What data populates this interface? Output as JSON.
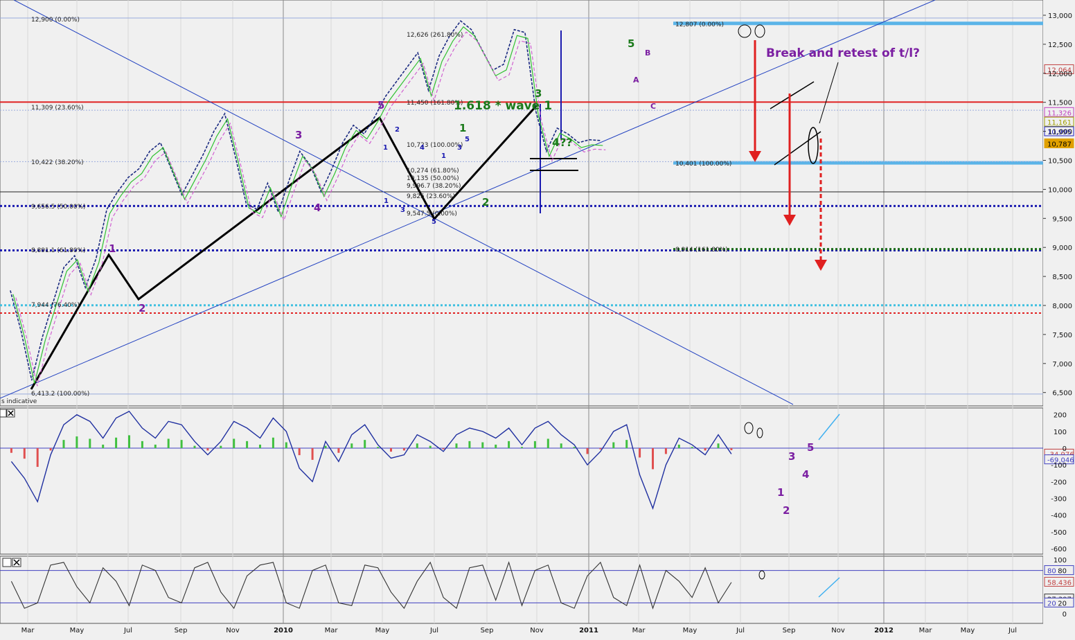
{
  "chart_data": {
    "type": "line",
    "title": "",
    "xlabel": "",
    "ylabel": "",
    "x_ticks": [
      "Mar",
      "May",
      "Jul",
      "Sep",
      "Nov",
      "2010",
      "Mar",
      "May",
      "Jul",
      "Sep",
      "Nov",
      "2011",
      "Mar",
      "May",
      "Jul",
      "Sep",
      "Nov",
      "2012",
      "Mar",
      "May",
      "Jul"
    ],
    "main_panel": {
      "ylim": [
        6400,
        13100
      ],
      "y_ticks": [
        "13,000",
        "12,500",
        "12,000",
        "11,500",
        "11,000",
        "10,500",
        "10,000",
        "9,500",
        "9,000",
        "8,500",
        "8,000",
        "7,500",
        "7,000",
        "6,500"
      ],
      "last_value_labels": [
        {
          "text": "12,064",
          "color": "#c04040",
          "value": 12064
        },
        {
          "text": "11,326",
          "color": "#c040c0",
          "value": 11326
        },
        {
          "text": "11,161",
          "color": "#a0a000",
          "value": 11161
        },
        {
          "text": "10,995",
          "color": "#2020c0",
          "value": 10995
        },
        {
          "text": "10,787",
          "color": "#e0a000",
          "value": 10787,
          "filled": true
        }
      ],
      "fib_labels": [
        {
          "text": "12,900 (0.00%)",
          "value": 12900
        },
        {
          "text": "12,626 (261.80%)",
          "value": 12626
        },
        {
          "text": "11,450 (161.80%)",
          "value": 11450
        },
        {
          "text": "11,309 (23.60%)",
          "value": 11309
        },
        {
          "text": "10,723 (100.00%)",
          "value": 10723
        },
        {
          "text": "10,422 (38.20%)",
          "value": 10422
        },
        {
          "text": "10,274 (61.80%)",
          "value": 10274
        },
        {
          "text": "10,135 (50.00%)",
          "value": 10135
        },
        {
          "text": "9,996.7 (38.20%)",
          "value": 9996.7
        },
        {
          "text": "9,825 (23.60%)",
          "value": 9825
        },
        {
          "text": "9,656.5 (50.00%)",
          "value": 9656.5
        },
        {
          "text": "9,547.5 (0.00%)",
          "value": 9547.5
        },
        {
          "text": "8,891.1 (61.80%)",
          "value": 8891.1
        },
        {
          "text": "7,944 (76.40%)",
          "value": 7944
        },
        {
          "text": "6,413.2 (100.00%)",
          "value": 6413.2
        },
        {
          "text": "12,807 (0.00%)",
          "value": 12807
        },
        {
          "text": "10,401 (100.00%)",
          "value": 10401
        },
        {
          "text": "8,914 (161.80%)",
          "value": 8914
        }
      ],
      "annotations": [
        "Break and retest of t/l?",
        "1.618 * wave 1",
        "4??",
        "s indicative"
      ],
      "wave_labels_purple": [
        "1",
        "2",
        "3",
        "4",
        "5",
        "A",
        "B",
        "C"
      ],
      "wave_labels_green": [
        "1",
        "2",
        "3",
        "4",
        "5"
      ],
      "wave_labels_blue": [
        "1",
        "2",
        "3",
        "4",
        "5"
      ],
      "series": [
        {
          "name": "price",
          "x": [
            0,
            2,
            4,
            6,
            8,
            10,
            12,
            14,
            16,
            18,
            20,
            22,
            24,
            26,
            28,
            30,
            32,
            34,
            36,
            38,
            40,
            42,
            44,
            46,
            48,
            50,
            52,
            54,
            56,
            58,
            60,
            62,
            64,
            66,
            68,
            70,
            72,
            74,
            76,
            78,
            80,
            82,
            84,
            86,
            88,
            90,
            92,
            94,
            96,
            98,
            100,
            102,
            104,
            106,
            108,
            110,
            112,
            114,
            116,
            118,
            120,
            122,
            124,
            126,
            128,
            130,
            132
          ],
          "values": [
            8200,
            7500,
            6650,
            7400,
            8000,
            8600,
            8800,
            8250,
            8750,
            9600,
            9900,
            10150,
            10300,
            10600,
            10750,
            10300,
            9850,
            10200,
            10550,
            10950,
            11250,
            10500,
            9700,
            9600,
            10050,
            9550,
            10100,
            10600,
            10350,
            9900,
            10300,
            10750,
            11050,
            10900,
            11200,
            11550,
            11800,
            12050,
            12300,
            11650,
            12250,
            12600,
            12850,
            12700,
            12350,
            12000,
            12100,
            12700,
            12650,
            11300,
            10600,
            11000,
            10900,
            10750,
            10800,
            10787
          ]
        },
        {
          "name": "macd",
          "x": [
            0,
            2,
            4,
            6,
            8,
            10,
            12,
            14,
            16,
            18,
            20,
            22,
            24,
            26,
            28,
            30,
            32,
            34,
            36,
            38,
            40,
            42,
            44,
            46,
            48,
            50,
            52,
            54,
            56,
            58,
            60,
            62,
            64,
            66,
            68,
            70,
            72,
            74,
            76,
            78,
            80,
            82,
            84,
            86,
            88,
            90,
            92,
            94,
            96,
            98,
            100,
            102,
            104,
            106,
            108,
            110
          ],
          "values": [
            -80,
            -180,
            -320,
            -40,
            140,
            200,
            160,
            60,
            180,
            220,
            120,
            60,
            160,
            140,
            40,
            -40,
            40,
            160,
            120,
            60,
            180,
            100,
            -120,
            -200,
            40,
            -80,
            80,
            140,
            20,
            -60,
            -40,
            80,
            40,
            -20,
            80,
            120,
            100,
            60,
            120,
            20,
            120,
            160,
            80,
            20,
            -100,
            -20,
            100,
            140,
            -160,
            -360,
            -100,
            60,
            20,
            -40,
            80,
            -35
          ]
        },
        {
          "name": "stoch",
          "x": [
            0,
            2,
            4,
            6,
            8,
            10,
            12,
            14,
            16,
            18,
            20,
            22,
            24,
            26,
            28,
            30,
            32,
            34,
            36,
            38,
            40,
            42,
            44,
            46,
            48,
            50,
            52,
            54,
            56,
            58,
            60,
            62,
            64,
            66,
            68,
            70,
            72,
            74,
            76,
            78,
            80,
            82,
            84,
            86,
            88,
            90,
            92,
            94,
            96,
            98,
            100,
            102,
            104,
            106,
            108,
            110
          ],
          "values": [
            60,
            10,
            20,
            90,
            95,
            50,
            20,
            85,
            60,
            15,
            90,
            80,
            30,
            20,
            85,
            95,
            40,
            10,
            70,
            90,
            95,
            20,
            10,
            80,
            90,
            20,
            15,
            90,
            85,
            40,
            10,
            60,
            95,
            30,
            10,
            85,
            90,
            25,
            95,
            15,
            80,
            90,
            20,
            10,
            70,
            95,
            30,
            15,
            90,
            10,
            80,
            60,
            30,
            85,
            20,
            58
          ]
        }
      ]
    },
    "macd_panel": {
      "ylim": [
        -620,
        230
      ],
      "y_ticks": [
        "200",
        "100",
        "0",
        "-100",
        "-200",
        "-300",
        "-400",
        "-500",
        "-600"
      ],
      "last_value_labels": [
        {
          "text": "-34.976",
          "color": "#c04040",
          "value": -34.976
        },
        {
          "text": "-69.046",
          "color": "#4040c0",
          "value": -69.046
        }
      ],
      "wave_labels": [
        "1",
        "2",
        "3",
        "4",
        "5"
      ]
    },
    "stoch_panel": {
      "ylim": [
        -5,
        105
      ],
      "y_ticks": [
        "100",
        "80",
        "20",
        "0"
      ],
      "last_value_labels": [
        {
          "text": "80",
          "color": "#4040c0",
          "value": 80
        },
        {
          "text": "58.436",
          "color": "#c04040",
          "value": 58.436
        },
        {
          "text": "27.397",
          "color": "#333333",
          "value": 27.397
        },
        {
          "text": "20",
          "color": "#4040c0",
          "value": 20
        }
      ]
    }
  }
}
